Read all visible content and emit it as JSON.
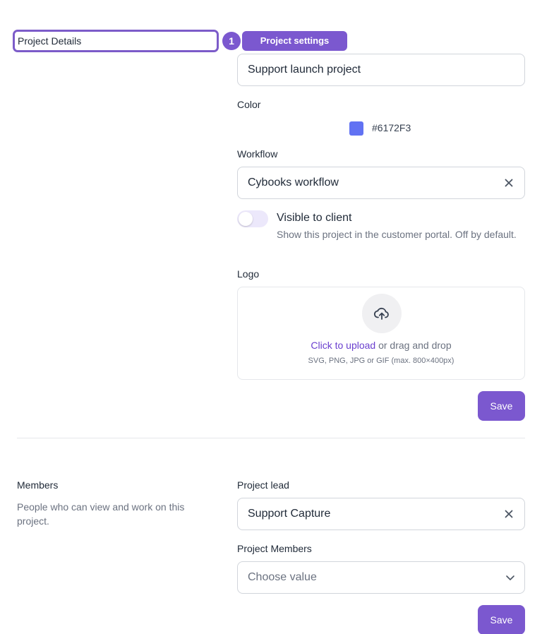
{
  "details": {
    "section_label": "Project Details",
    "step_number": "1",
    "step_label": "Project settings",
    "project_name": "Support launch project",
    "color_label": "Color",
    "color_value": "#6172F3",
    "workflow_label": "Workflow",
    "workflow_value": "Cybooks workflow",
    "visible_title": "Visible to client",
    "visible_desc": "Show this project in the customer portal. Off by default.",
    "visible_on": false,
    "logo_label": "Logo",
    "upload_link": "Click to upload",
    "upload_text": " or drag and drop",
    "upload_hint": "SVG, PNG, JPG or GIF (max. 800×400px)",
    "save_label": "Save"
  },
  "members": {
    "title": "Members",
    "desc": "People who can view and work on this project.",
    "lead_label": "Project lead",
    "lead_value": "Support Capture",
    "members_label": "Project Members",
    "members_placeholder": "Choose value",
    "save_label": "Save"
  },
  "icons": {
    "clear": "close-icon",
    "dropdown": "chevron-down-icon",
    "upload": "upload-cloud-icon"
  },
  "colors": {
    "accent": "#7b58cf",
    "swatch": "#6172f3",
    "link": "#6a3fcf"
  }
}
